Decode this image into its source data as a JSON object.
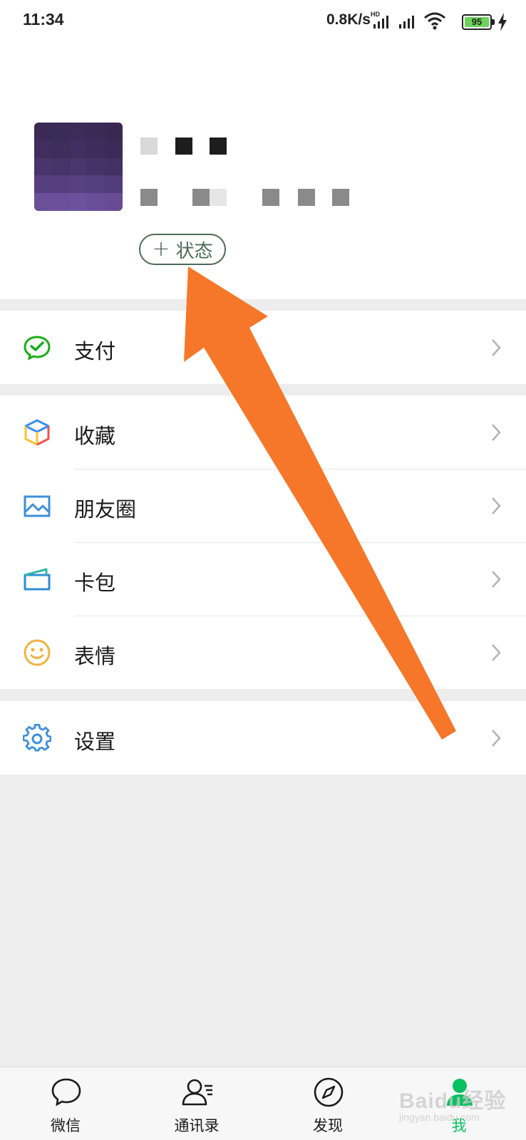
{
  "status_bar": {
    "time": "11:34",
    "net_speed": "0.8K/s",
    "hd_label": "HD",
    "battery": "95"
  },
  "profile": {
    "status_button": {
      "plus": "+",
      "label": "状态"
    }
  },
  "menu": {
    "pay": {
      "label": "支付"
    },
    "favorites": {
      "label": "收藏"
    },
    "moments": {
      "label": "朋友圈"
    },
    "cards": {
      "label": "卡包"
    },
    "stickers": {
      "label": "表情"
    },
    "settings": {
      "label": "设置"
    }
  },
  "tabbar": {
    "tabs": [
      {
        "label": "微信",
        "icon": "chat-bubble-icon"
      },
      {
        "label": "通讯录",
        "icon": "contacts-icon"
      },
      {
        "label": "发现",
        "icon": "compass-icon"
      },
      {
        "label": "我",
        "icon": "person-icon"
      }
    ],
    "active": "我"
  },
  "watermark": {
    "text": "Baidu经验",
    "sub": "jingyan.baidu.com"
  },
  "colors": {
    "accent_green": "#07c160",
    "annotation_arrow": "#f6772a",
    "status_pill_border": "#4e6a5c"
  }
}
